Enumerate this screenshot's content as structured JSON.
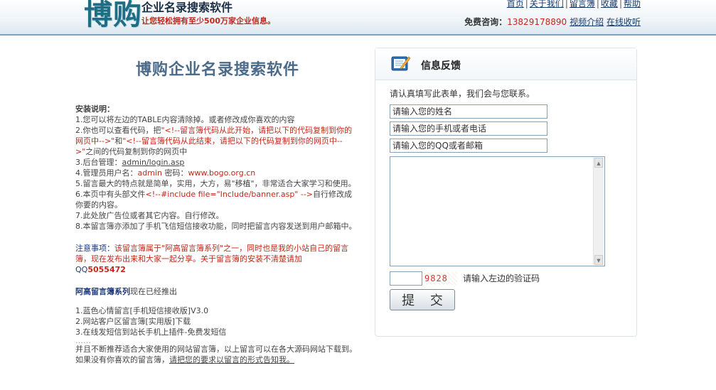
{
  "header": {
    "logo_mark": "博购",
    "logo_title": "企业名录搜索软件",
    "logo_slogan": "让您轻松拥有至少500万家企业信息。",
    "nav": [
      "首页",
      "关于我们",
      "留言簿",
      "收藏",
      "帮助"
    ],
    "contact_label": "免费咨询：",
    "contact_phone": "13829178890",
    "video_intro": "视频介绍",
    "online_pay": "在线收听"
  },
  "left": {
    "title": "博购企业名录搜索软件",
    "install_heading": "安装说明：",
    "line1": "1.您可以将左边的TABLE内容清除掉。或者修改成你喜欢的内容",
    "line2_a": "2.你也可以查看代码，把",
    "line2_b": "\"<!--留言簿代码从此开始，请把以下的代码复制到你的网页中-->\"",
    "line2_c": "和",
    "line2_d": "\"<!--留言簿代码从此结束，请把以下的代码复制到你的网页中-->\"",
    "line2_e": "之间的代码复制到你的网页中",
    "line3_a": "3.后台管理：",
    "line3_link": "admin/login.asp",
    "line4_a": "4.管理员用户名：",
    "line4_user": "admin",
    "line4_b": " 密码：",
    "line4_pwd": "www.bogo.org.cn",
    "line5": "5.留言最大的特点就是简单，实用，大方，易\"移植\"，非常适合大家学习和使用。",
    "line6_a": "6.本页中有头部文件",
    "line6_b": "<!--#include file=\"Include/banner.asp\" -->",
    "line6_c": "自行修改成你要的内容。",
    "line7": "7.此处放广告位或者其它内容。自行修改。",
    "line8": "8.本留言簿亦添加了手机飞信短信接收功能，同时把留言内容发送到用户邮箱中。",
    "note_label": "注意事项：",
    "note_text": "该留言簿属于\"阿高留言簿系列\"之一，同时也是我的小站自己的留言簿，现在发布出来和大家一起分享。关于留言簿的安装不清楚请加",
    "note_qq_label": "QQ",
    "note_qq": "5055472",
    "series_label": "阿高留言簿系列",
    "series_text": "现在已经推出",
    "s1": "1.蓝色心情留言[手机短信接收版]V3.0",
    "s2": "2.网站客户区留言簿[实用版]下载",
    "s3": "3.在线发短信到站长手机上插件-免费发短信",
    "dots": "……",
    "closing_a": "并且不断推荐适合大家使用的网站留言簿，以上留言可以在各大源码网站下载到。如果没有你喜欢的留言簿，",
    "closing_link": "请把您的要求以留言的形式告知我。"
  },
  "form": {
    "panel_title": "信息反馈",
    "hint": "请认真填写此表单，我们会与您联系。",
    "name_placeholder": "请输入您的姓名",
    "phone_placeholder": "请输入您的手机或者电话",
    "qq_placeholder": "请输入您的QQ或者邮箱",
    "captcha_code": "9828",
    "captcha_hint": "请输入左边的验证码",
    "submit_label": "提 交"
  }
}
